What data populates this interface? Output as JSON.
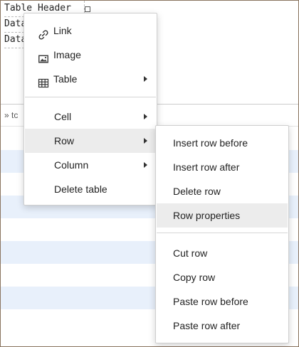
{
  "editor": {
    "cells": [
      "Table Header",
      "Data",
      "Data"
    ],
    "status_path": "» tc"
  },
  "context_menu": {
    "items": [
      {
        "label": "Link",
        "icon": "link-icon"
      },
      {
        "label": "Image",
        "icon": "image-icon"
      },
      {
        "label": "Table",
        "icon": "table-icon",
        "has_submenu": true
      },
      {
        "label": "Cell",
        "has_submenu": true
      },
      {
        "label": "Row",
        "has_submenu": true,
        "active": true
      },
      {
        "label": "Column",
        "has_submenu": true
      },
      {
        "label": "Delete table"
      }
    ]
  },
  "row_submenu": {
    "items": [
      {
        "label": "Insert row before"
      },
      {
        "label": "Insert row after"
      },
      {
        "label": "Delete row"
      },
      {
        "label": "Row properties",
        "active": true
      },
      {
        "label": "Cut row"
      },
      {
        "label": "Copy row"
      },
      {
        "label": "Paste row before"
      },
      {
        "label": "Paste row after"
      }
    ]
  },
  "colors": {
    "frame_border": "#8a7460",
    "stripe": "#e8f0fb",
    "menu_active": "#ececec"
  }
}
